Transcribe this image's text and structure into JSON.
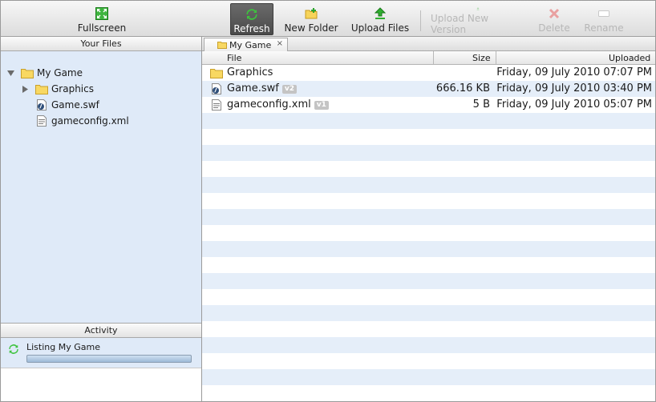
{
  "toolbar": {
    "fullscreen": "Fullscreen",
    "refresh": "Refresh",
    "new_folder": "New Folder",
    "upload_files": "Upload Files",
    "upload_new_version": "Upload New Version",
    "delete": "Delete",
    "rename": "Rename"
  },
  "left": {
    "header": "Your Files",
    "tree": {
      "root": "My Game",
      "children": [
        "Graphics",
        "Game.swf",
        "gameconfig.xml"
      ]
    },
    "activity": {
      "header": "Activity",
      "status": "Listing My Game"
    }
  },
  "right": {
    "tab": "My Game",
    "tab_close": "×",
    "columns": {
      "file": "File",
      "size": "Size",
      "uploaded": "Uploaded"
    },
    "files": [
      {
        "name": "Graphics",
        "version": "",
        "size": "",
        "uploaded": "Friday, 09 July 2010 07:07 PM",
        "icon": "folder-icon"
      },
      {
        "name": "Game.swf",
        "version": "v2",
        "size": "666.16 KB",
        "uploaded": "Friday, 09 July 2010 03:40 PM",
        "icon": "swf-file-icon"
      },
      {
        "name": "gameconfig.xml",
        "version": "v1",
        "size": "5 B",
        "uploaded": "Friday, 09 July 2010 05:07 PM",
        "icon": "xml-file-icon"
      }
    ]
  },
  "colors": {
    "accent": "#dfeaf8",
    "stripe": "#e5eef9",
    "active_button": "#4f4f4f"
  }
}
